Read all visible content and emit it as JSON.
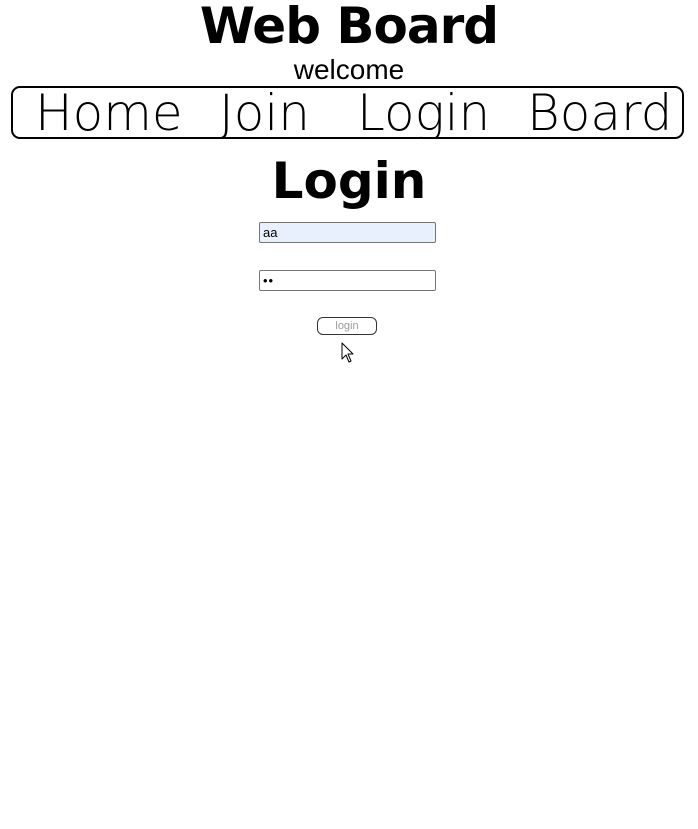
{
  "header": {
    "title": "Web Board",
    "subtitle": "welcome"
  },
  "nav": {
    "items": [
      {
        "label": "Home"
      },
      {
        "label": "Join"
      },
      {
        "label": "Login"
      },
      {
        "label": "Board"
      }
    ]
  },
  "main": {
    "heading": "Login",
    "id_field": {
      "value": "aa",
      "placeholder": ""
    },
    "password_field": {
      "value": "aa",
      "placeholder": ""
    },
    "login_button": {
      "label": "login"
    }
  },
  "icons": {
    "cursor": "mouse-pointer-icon"
  },
  "colors": {
    "autofill_background": "#e8f0fe",
    "button_text": "#9a9a9a"
  }
}
